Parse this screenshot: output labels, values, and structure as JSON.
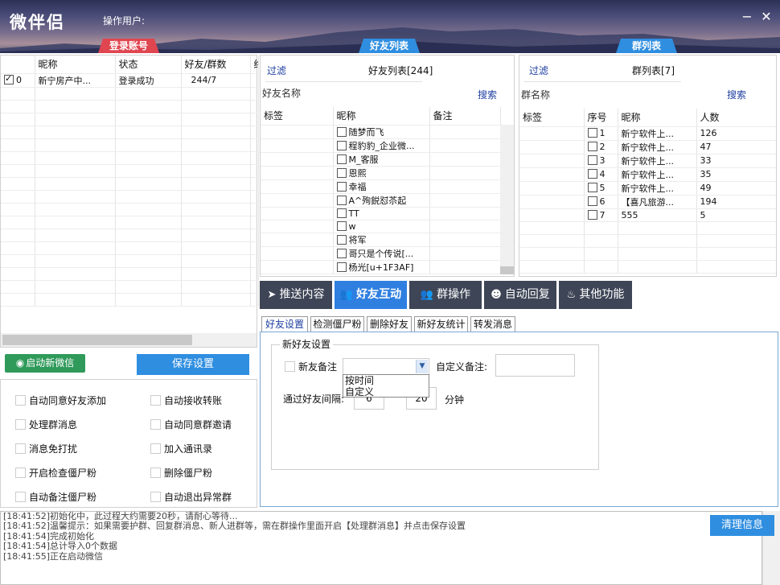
{
  "app": {
    "title": "微伴侣",
    "operator_label": "操作用户:",
    "min_icon": "minimize-icon",
    "close_icon": "close-icon"
  },
  "header_tabs": {
    "login": "登录账号",
    "friends": "好友列表",
    "groups": "群列表"
  },
  "accounts": {
    "columns": [
      "",
      "昵称",
      "状态",
      "好友/群数",
      "终"
    ],
    "rows": [
      {
        "checked": true,
        "index": "0",
        "nickname": "新宁房产中...",
        "status": "登录成功",
        "count": "244/7"
      }
    ]
  },
  "friends": {
    "filter_label": "过滤",
    "title": "好友列表[244]",
    "name_label": "好友名称",
    "search_label": "搜索",
    "columns": [
      "标签",
      "昵称",
      "备注"
    ],
    "rows": [
      "随梦而飞",
      "程豹豹_企业微...",
      "M_客服",
      "恩熙",
      "幸福",
      "A^殉鋭怼苶起",
      "TT",
      "w",
      "将军",
      "哥只是个传说[...",
      "杨光[u+1F3AF]"
    ]
  },
  "groups": {
    "filter_label": "过滤",
    "title": "群列表[7]",
    "name_label": "群名称",
    "search_label": "搜索",
    "columns": [
      "标签",
      "序号",
      "昵称",
      "人数"
    ],
    "rows": [
      {
        "no": "1",
        "name": "新宁软件上...",
        "count": "126"
      },
      {
        "no": "2",
        "name": "新宁软件上...",
        "count": "47"
      },
      {
        "no": "3",
        "name": "新宁软件上...",
        "count": "33"
      },
      {
        "no": "4",
        "name": "新宁软件上...",
        "count": "35"
      },
      {
        "no": "5",
        "name": "新宁软件上...",
        "count": "49"
      },
      {
        "no": "6",
        "name": "【喜凡旅游...",
        "count": "194"
      },
      {
        "no": "7",
        "name": "555",
        "count": "5"
      }
    ]
  },
  "toolbar": {
    "push": "推送内容",
    "friend_interact": "好友互动",
    "group_ops": "群操作",
    "auto_reply": "自动回复",
    "other": "其他功能"
  },
  "subtabs": [
    "好友设置",
    "检测僵尸粉",
    "删除好友",
    "新好友统计",
    "转发消息"
  ],
  "new_friend": {
    "group_label": "新好友设置",
    "remark_label": "新友备注",
    "custom_remark_label": "自定义备注:",
    "custom_remark_value": "",
    "interval_label": "通过好友间隔:",
    "interval_from": "6",
    "interval_to": "20",
    "interval_unit": "分钟",
    "dropdown_options": [
      "按时间",
      "自定义"
    ]
  },
  "left_buttons": {
    "start": "启动新微信",
    "save": "保存设置"
  },
  "options": [
    [
      "自动同意好友添加",
      "自动接收转账"
    ],
    [
      "处理群消息",
      "自动同意群邀请"
    ],
    [
      "消息免打扰",
      "加入通讯录"
    ],
    [
      "开启检查僵尸粉",
      "删除僵尸粉"
    ],
    [
      "自动备注僵尸粉",
      "自动退出异常群"
    ]
  ],
  "log": {
    "lines": [
      "[18:41:52]初始化中，此过程大约需要20秒，请耐心等待...",
      "[18:41:52]温馨提示：如果需要护群、回复群消息、新人进群等，需在群操作里面开启【处理群消息】并点击保存设置",
      "[18:41:54]完成初始化",
      "[18:41:54]总计导入0个数据",
      "[18:41:55]正在启动微信"
    ],
    "clear_label": "清理信息"
  },
  "colors": {
    "accent": "#2f7fe0",
    "login_tab": "#e04650",
    "toolbar_bg": "#3e4556",
    "start_button": "#2f9a5a",
    "save_button": "#2f8ee0"
  }
}
